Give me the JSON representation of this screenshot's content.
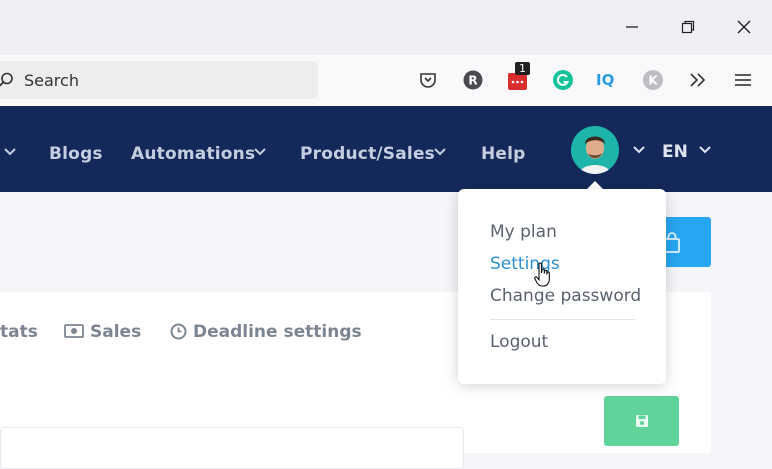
{
  "browser": {
    "search_placeholder": "Search",
    "notification_badge": "1",
    "extensions": [
      "pocket-icon",
      "r-icon",
      "notification-icon",
      "grammarly-icon",
      "iq-icon",
      "k-icon",
      "overflow-icon",
      "menu-icon"
    ]
  },
  "nav": {
    "items": [
      {
        "label": "Blogs"
      },
      {
        "label": "Automations"
      },
      {
        "label": "Product/Sales"
      },
      {
        "label": "Help"
      }
    ],
    "language": "EN"
  },
  "tabs": [
    {
      "label": "tats"
    },
    {
      "label": "Sales"
    },
    {
      "label": "Deadline settings"
    }
  ],
  "dropdown": {
    "items": [
      {
        "label": "My plan"
      },
      {
        "label": "Settings"
      },
      {
        "label": "Change password"
      },
      {
        "label": "Logout"
      }
    ]
  },
  "colors": {
    "nav_bg": "#14295a",
    "accent_blue": "#27a6f1",
    "save_green": "#5fd39a",
    "link_active": "#2a8fd0"
  }
}
